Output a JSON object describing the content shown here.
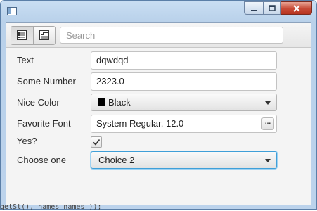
{
  "window": {
    "icon": "app-window-icon",
    "buttons": {
      "minimize_icon": "minimize-icon",
      "maximize_icon": "maximize-icon",
      "close_icon": "close-icon",
      "close_color": "#c74a36"
    }
  },
  "toolbar": {
    "view_buttons": [
      "list-view-icon",
      "detail-view-icon"
    ],
    "search_placeholder": "Search"
  },
  "form": {
    "text": {
      "label": "Text",
      "value": "dqwdqd"
    },
    "some_number": {
      "label": "Some Number",
      "value": "2323.0"
    },
    "nice_color": {
      "label": "Nice Color",
      "value": "Black",
      "swatch": "#000000"
    },
    "favorite_font": {
      "label": "Favorite Font",
      "value": "System Regular, 12.0",
      "button": "..."
    },
    "yes": {
      "label": "Yes?",
      "checked": true
    },
    "choose_one": {
      "label": "Choose one",
      "value": "Choice 2"
    }
  },
  "background": {
    "text": "getSt(), names names ));"
  },
  "colors": {
    "focus": "#3f9fd8",
    "window_frame": "#b9d1ea"
  }
}
